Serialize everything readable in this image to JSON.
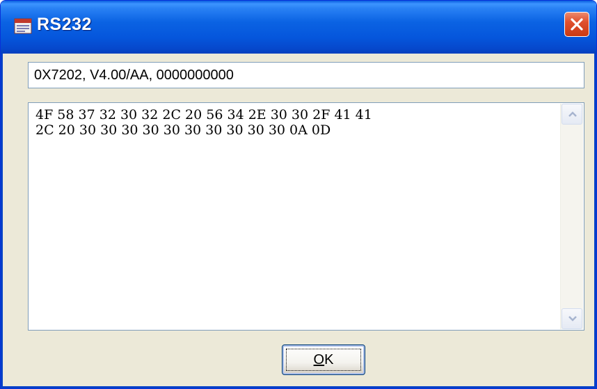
{
  "window": {
    "title": "RS232",
    "icon": "app-window-icon",
    "close_icon": "close-icon"
  },
  "summary": {
    "value": "0X7202, V4.00/AA, 0000000000"
  },
  "hex_output": {
    "lines": [
      "4F 58 37 32 30 32 2C 20 56 34 2E 30 30 2F 41 41",
      "2C 20 30 30 30 30 30 30 30 30 30 30 0A 0D"
    ]
  },
  "buttons": {
    "ok_accel": "O",
    "ok_rest": "K"
  },
  "colors": {
    "titlebar": "#0a5fe0",
    "close_button": "#e0502e",
    "dialog_face": "#ece9d8",
    "field_border": "#7f9db9"
  }
}
